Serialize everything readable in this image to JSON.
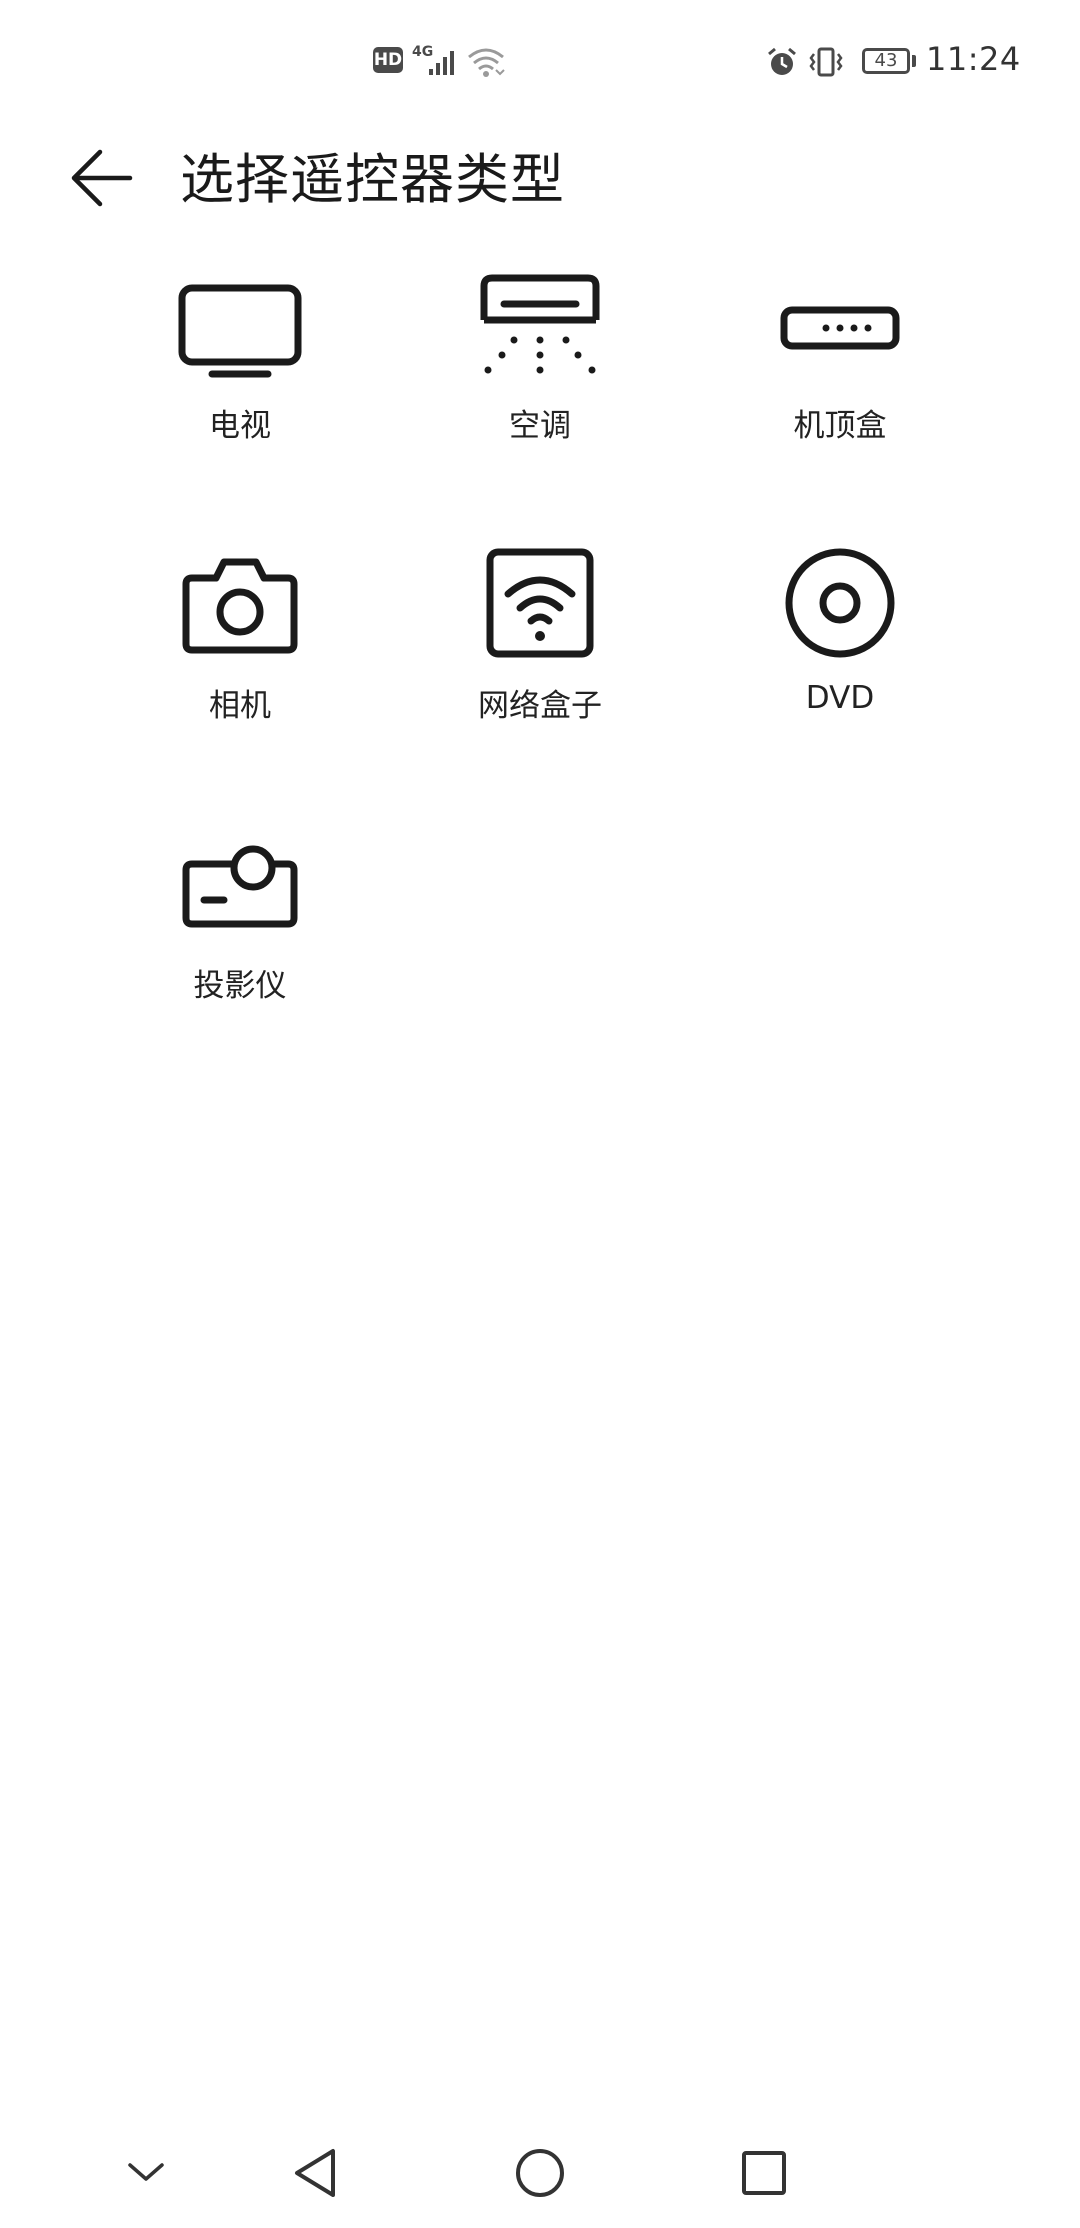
{
  "status_bar": {
    "hd": "HD",
    "network": "4G",
    "battery": "43",
    "time": "11:24",
    "icons": [
      "signal-icon",
      "wifi-icon",
      "alarm-icon",
      "vibrate-icon",
      "battery-icon"
    ]
  },
  "header": {
    "title": "选择遥控器类型",
    "back_icon": "arrow-left-icon"
  },
  "devices": [
    {
      "label": "电视",
      "icon": "tv-icon"
    },
    {
      "label": "空调",
      "icon": "air-conditioner-icon"
    },
    {
      "label": "机顶盒",
      "icon": "set-top-box-icon"
    },
    {
      "label": "相机",
      "icon": "camera-icon"
    },
    {
      "label": "网络盒子",
      "icon": "network-box-icon"
    },
    {
      "label": "DVD",
      "icon": "dvd-icon"
    },
    {
      "label": "投影仪",
      "icon": "projector-icon"
    }
  ],
  "nav_bar": {
    "icons": [
      "hide-nav-icon",
      "back-triangle-icon",
      "home-circle-icon",
      "recents-square-icon"
    ]
  },
  "colors": {
    "icon_stroke": "#1a1a1a",
    "status_gray": "#4a4a4a",
    "background": "#ffffff"
  }
}
